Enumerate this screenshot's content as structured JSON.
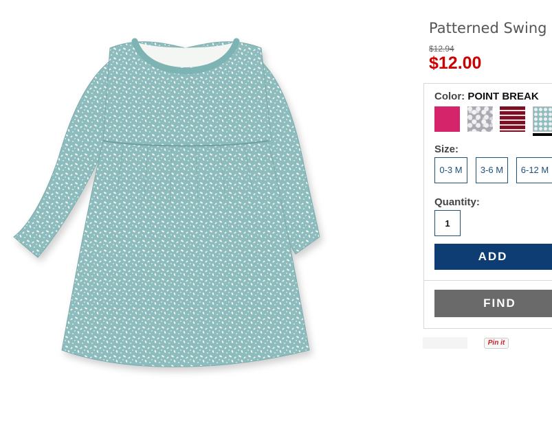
{
  "product": {
    "title": "Patterned Swing D",
    "old_price": "$12.94",
    "price": "$12.00"
  },
  "color": {
    "label": "Color:",
    "value": "POINT BREAK",
    "swatches": [
      "pink-swatch",
      "grey-floral-swatch",
      "burgundy-stripe-swatch",
      "teal-print-swatch"
    ],
    "selected_index": 3
  },
  "size": {
    "label": "Size:",
    "options": [
      "0-3 M",
      "3-6 M",
      "6-12 M"
    ]
  },
  "quantity": {
    "label": "Quantity:",
    "value": "1"
  },
  "buttons": {
    "add": "ADD",
    "find": "FIND",
    "pinit": "Pin it"
  },
  "colors": {
    "price_red": "#cc0000",
    "add_button": "#0d3d73",
    "find_button": "#6a6a6a",
    "size_border": "#1d4f7c",
    "dress_teal": "#8cbcbe"
  }
}
